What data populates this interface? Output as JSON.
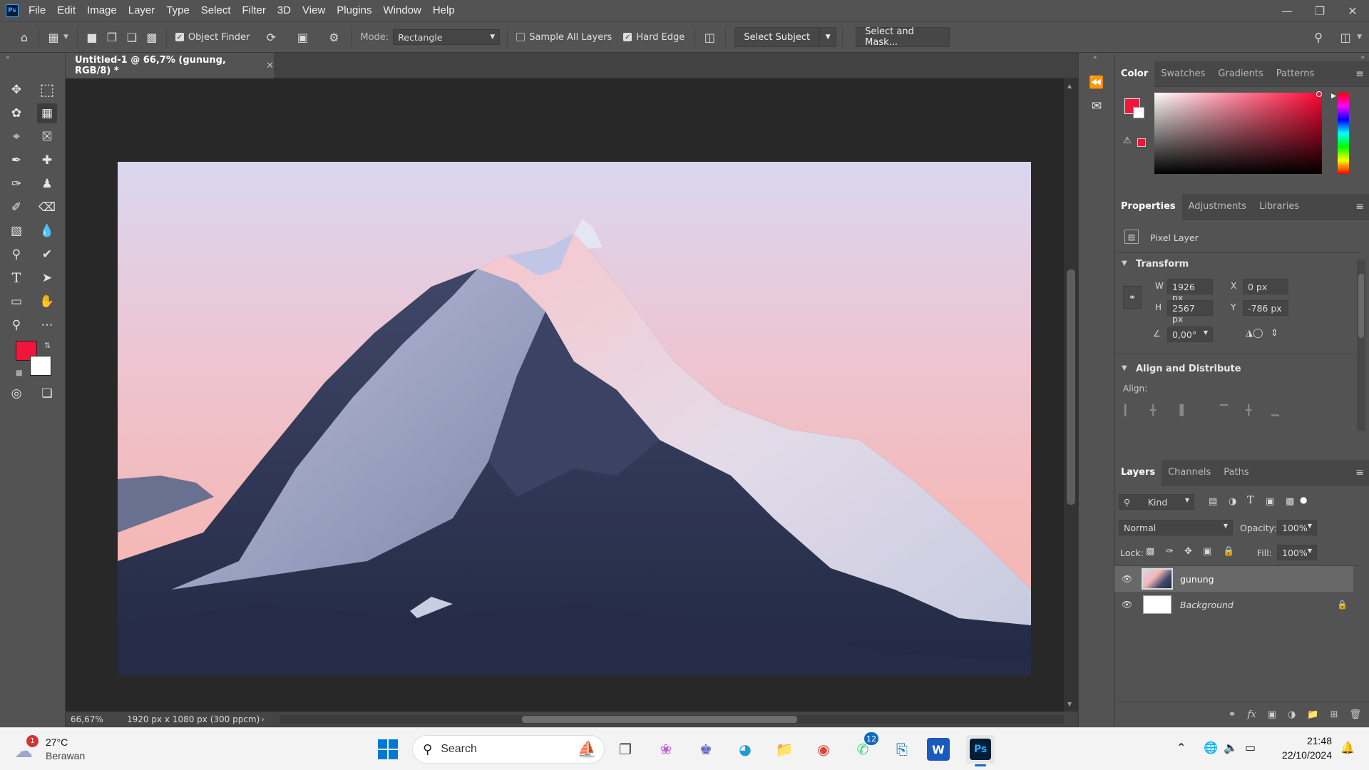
{
  "app": {
    "logo": "Ps",
    "menus": [
      "File",
      "Edit",
      "Image",
      "Layer",
      "Type",
      "Select",
      "Filter",
      "3D",
      "View",
      "Plugins",
      "Window",
      "Help"
    ]
  },
  "options": {
    "object_finder": "Object Finder",
    "mode_label": "Mode:",
    "mode_value": "Rectangle",
    "sample_all_layers": "Sample All Layers",
    "hard_edge": "Hard Edge",
    "select_subject": "Select Subject",
    "select_and_mask": "Select and Mask..."
  },
  "document": {
    "tab_title": "Untitled-1 @ 66,7% (gunung, RGB/8) *",
    "zoom": "66,67%",
    "doc_info": "1920 px x 1080 px (300 ppcm)",
    "foreground_color": "#f0163a",
    "background_color": "#ffffff"
  },
  "color_panel": {
    "tabs": [
      "Color",
      "Swatches",
      "Gradients",
      "Patterns"
    ]
  },
  "properties": {
    "tabs": [
      "Properties",
      "Adjustments",
      "Libraries"
    ],
    "layer_type": "Pixel Layer",
    "transform_title": "Transform",
    "w_label": "W",
    "w_value": "1926 px",
    "h_label": "H",
    "h_value": "2567 px",
    "x_label": "X",
    "x_value": "0 px",
    "y_label": "Y",
    "y_value": "-786 px",
    "angle": "0,00°",
    "align_title": "Align and Distribute",
    "align_label": "Align:"
  },
  "layers_panel": {
    "tabs": [
      "Layers",
      "Channels",
      "Paths"
    ],
    "kind": "Kind",
    "blend_mode": "Normal",
    "opacity_label": "Opacity:",
    "opacity": "100%",
    "lock_label": "Lock:",
    "fill_label": "Fill:",
    "fill": "100%",
    "layers": [
      {
        "name": "gunung"
      },
      {
        "name": "Background"
      }
    ]
  },
  "taskbar": {
    "weather_temp": "27°C",
    "weather_desc": "Berawan",
    "weather_badge": "1",
    "search_placeholder": "Search",
    "whatsapp_badge": "12",
    "ps_label": "Ps",
    "time": "21:48",
    "date": "22/10/2024"
  }
}
